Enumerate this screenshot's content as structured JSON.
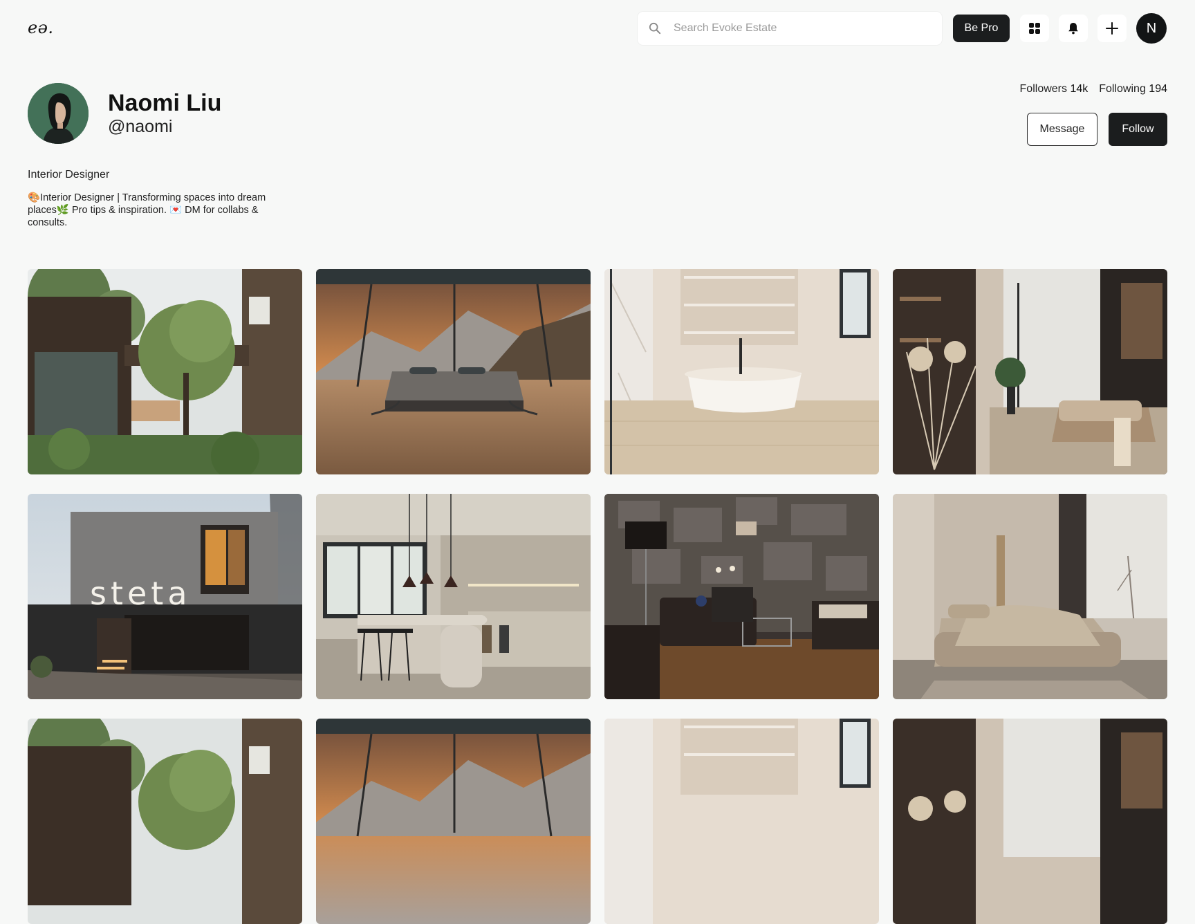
{
  "header": {
    "logo": "eə.",
    "search_placeholder": "Search Evoke Estate",
    "be_pro_label": "Be Pro",
    "avatar_initial": "N"
  },
  "profile": {
    "name": "Naomi Liu",
    "handle": "@naomi",
    "followers_label": "Followers",
    "followers_count": "14k",
    "following_label": "Following",
    "following_count": "194",
    "message_label": "Message",
    "follow_label": "Follow",
    "role": "Interior Designer",
    "bio": "🎨Interior Designer | Transforming spaces into dream places🌿 Pro tips & inspiration. 💌 DM for collabs & consults."
  },
  "gallery": {
    "items": [
      {
        "scene": "courtyard-house"
      },
      {
        "scene": "mountain-bedroom"
      },
      {
        "scene": "white-bathtub"
      },
      {
        "scene": "living-room-pampas"
      },
      {
        "scene": "steta-facade",
        "sign_text": "steta"
      },
      {
        "scene": "kitchen-island"
      },
      {
        "scene": "stone-wall-lounge"
      },
      {
        "scene": "beige-bedroom"
      },
      {
        "scene": "courtyard-house"
      },
      {
        "scene": "mountain-bedroom"
      },
      {
        "scene": "white-bathtub"
      },
      {
        "scene": "living-room-pampas"
      }
    ]
  },
  "colors": {
    "background": "#f7f8f7",
    "dark_button": "#1b1d1e",
    "text": "#1a1a1a"
  }
}
